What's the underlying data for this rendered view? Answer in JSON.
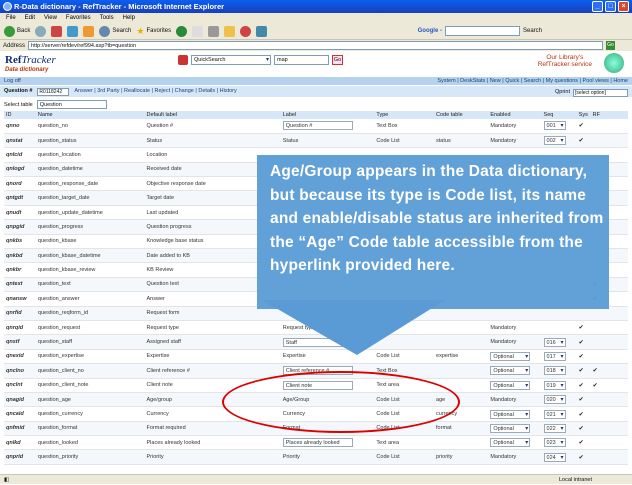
{
  "window": {
    "title": "R-Data dictionary - RefTracker - Microsoft Internet Explorer"
  },
  "menu": [
    "File",
    "Edit",
    "View",
    "Favorites",
    "Tools",
    "Help"
  ],
  "toolbar": {
    "back": "Back",
    "search": "Search",
    "favorites": "Favorites",
    "google_label": "Google -",
    "search_btn": "Search"
  },
  "address": {
    "label": "Address",
    "url": "http://server/refdev/ref994.asp?tb=question",
    "go": "Go"
  },
  "app": {
    "logo_bold": "Ref",
    "logo_italic": "Tracker",
    "subtitle": "Data dictionary",
    "quicksearch_label": "QuickSearch",
    "quicksearch_value": "map",
    "go": "Go",
    "library_line1": "Our Library's",
    "library_line2": "RefTracker service"
  },
  "nav": {
    "logoff": "Log off",
    "links": "System | DeskStats | New | Quick | Search | My questions | Pool views | Home"
  },
  "qbar": {
    "label": "Question #",
    "value": "R0118242",
    "actions": "Answer | 3rd Party | Reallocate | Reject | Change | Details | History",
    "qprint": "Qprint",
    "option": "[select option]"
  },
  "table_select": {
    "label": "Select table",
    "value": "Question"
  },
  "columns": [
    "ID",
    "Name",
    "Default label",
    "Label",
    "Type",
    "Code table",
    "Enabled",
    "Seq",
    "Sys",
    "RF"
  ],
  "rows": [
    {
      "id": "qnno",
      "name": "question_no",
      "default": "Question #",
      "label": "Question #",
      "type": "Text Box",
      "code": "",
      "enabled": "Mandatory",
      "seq": "001",
      "sys": "✔",
      "rf": "",
      "input": true,
      "sel": false
    },
    {
      "id": "qnstat",
      "name": "question_status",
      "default": "Status",
      "label": "Status",
      "type": "Code List",
      "code": "status",
      "enabled": "Mandatory",
      "seq": "002",
      "sys": "✔",
      "rf": "",
      "input": false,
      "sel": false
    },
    {
      "id": "qnlcid",
      "name": "question_location",
      "default": "Location",
      "label": "",
      "type": "",
      "code": "",
      "enabled": "",
      "seq": "",
      "sys": "",
      "rf": "",
      "input": false,
      "sel": false
    },
    {
      "id": "qnlogd",
      "name": "question_datetime",
      "default": "Received date",
      "label": "",
      "type": "",
      "code": "",
      "enabled": "",
      "seq": "",
      "sys": "",
      "rf": "",
      "input": false,
      "sel": false
    },
    {
      "id": "qnord",
      "name": "question_response_date",
      "default": "Objective response date",
      "label": "",
      "type": "",
      "code": "",
      "enabled": "",
      "seq": "",
      "sys": "",
      "rf": "",
      "input": false,
      "sel": false
    },
    {
      "id": "qntgdt",
      "name": "question_target_date",
      "default": "Target date",
      "label": "",
      "type": "",
      "code": "",
      "enabled": "",
      "seq": "",
      "sys": "",
      "rf": "",
      "input": false,
      "sel": false
    },
    {
      "id": "qnudt",
      "name": "question_update_datetime",
      "default": "Last updated",
      "label": "",
      "type": "",
      "code": "",
      "enabled": "",
      "seq": "",
      "sys": "",
      "rf": "",
      "input": false,
      "sel": false
    },
    {
      "id": "qnpgid",
      "name": "question_progress",
      "default": "Question progress",
      "label": "",
      "type": "",
      "code": "",
      "enabled": "",
      "seq": "",
      "sys": "",
      "rf": "",
      "input": false,
      "sel": false
    },
    {
      "id": "qnkbs",
      "name": "question_kbase",
      "default": "Knowledge base status",
      "label": "",
      "type": "",
      "code": "",
      "enabled": "",
      "seq": "",
      "sys": "",
      "rf": "",
      "input": false,
      "sel": false
    },
    {
      "id": "qnkbd",
      "name": "question_kbase_datetime",
      "default": "Date added to KB",
      "label": "",
      "type": "",
      "code": "",
      "enabled": "",
      "seq": "",
      "sys": "",
      "rf": "",
      "input": false,
      "sel": false
    },
    {
      "id": "qnkbr",
      "name": "question_kbase_review",
      "default": "KB Review",
      "label": "",
      "type": "",
      "code": "",
      "enabled": "",
      "seq": "",
      "sys": "",
      "rf": "",
      "input": false,
      "sel": false
    },
    {
      "id": "qntext",
      "name": "question_text",
      "default": "Question text",
      "label": "",
      "type": "",
      "code": "",
      "enabled": "",
      "seq": "",
      "sys": "",
      "rf": "✔",
      "input": false,
      "sel": false
    },
    {
      "id": "qnansw",
      "name": "question_answer",
      "default": "Answer",
      "label": "",
      "type": "",
      "code": "",
      "enabled": "",
      "seq": "",
      "sys": "",
      "rf": "✔",
      "input": false,
      "sel": false
    },
    {
      "id": "qnrfid",
      "name": "question_reqform_id",
      "default": "Request form",
      "label": "",
      "type": "",
      "code": "",
      "enabled": "",
      "seq": "",
      "sys": "",
      "rf": "",
      "input": false,
      "sel": false
    },
    {
      "id": "qnrqid",
      "name": "question_request",
      "default": "Request type",
      "label": "Request type",
      "type": "",
      "code": "",
      "enabled": "Mandatory",
      "seq": "",
      "sys": "✔",
      "rf": "",
      "input": false,
      "sel": false
    },
    {
      "id": "qnstf",
      "name": "question_staff",
      "default": "Assigned staff",
      "label": "Staff",
      "type": "",
      "code": "",
      "enabled": "Mandatory",
      "seq": "016",
      "sys": "✔",
      "rf": "",
      "input": true,
      "sel": false
    },
    {
      "id": "qnexid",
      "name": "question_expertise",
      "default": "Expertise",
      "label": "Expertise",
      "type": "Code List",
      "code": "expertise",
      "enabled": "Optional",
      "seq": "017",
      "sys": "✔",
      "rf": "",
      "input": false,
      "sel": true
    },
    {
      "id": "qnclno",
      "name": "question_client_no",
      "default": "Client reference #",
      "label": "Client reference #",
      "type": "Text Box",
      "code": "",
      "enabled": "Optional",
      "seq": "018",
      "sys": "✔",
      "rf": "✔",
      "input": true,
      "sel": true
    },
    {
      "id": "qnclnt",
      "name": "question_client_note",
      "default": "Client note",
      "label": "Client note",
      "type": "Text area",
      "code": "",
      "enabled": "Optional",
      "seq": "019",
      "sys": "✔",
      "rf": "✔",
      "input": true,
      "sel": true
    },
    {
      "id": "qnagid",
      "name": "question_age",
      "default": "Age/group",
      "label": "Age/Group",
      "type": "Code List",
      "code": "age",
      "enabled": "Mandatory",
      "seq": "020",
      "sys": "✔",
      "rf": "",
      "input": false,
      "sel": false
    },
    {
      "id": "qncaid",
      "name": "question_currency",
      "default": "Currency",
      "label": "Currency",
      "type": "Code List",
      "code": "currency",
      "enabled": "Optional",
      "seq": "021",
      "sys": "✔",
      "rf": "",
      "input": false,
      "sel": true
    },
    {
      "id": "qnfmid",
      "name": "question_format",
      "default": "Format required",
      "label": "Format",
      "type": "Code List",
      "code": "format",
      "enabled": "Optional",
      "seq": "022",
      "sys": "✔",
      "rf": "",
      "input": false,
      "sel": true
    },
    {
      "id": "qnlkd",
      "name": "question_looked",
      "default": "Places already looked",
      "label": "Places already looked",
      "type": "Text area",
      "code": "",
      "enabled": "Optional",
      "seq": "023",
      "sys": "✔",
      "rf": "",
      "input": true,
      "sel": true
    },
    {
      "id": "qnprid",
      "name": "question_priority",
      "default": "Priority",
      "label": "Priority",
      "type": "Code List",
      "code": "priority",
      "enabled": "Mandatory",
      "seq": "024",
      "sys": "✔",
      "rf": "",
      "input": false,
      "sel": false
    }
  ],
  "callout": {
    "text": "Age/Group appears in the Data dictionary, but because its type is Code list, its name and enable/disable status are inherited from the “Age” Code table accessible from the hyperlink provided here."
  },
  "status": {
    "zone": "Local intranet"
  },
  "colors": {
    "callout": "#5a9bd6",
    "oval": "#dd0000",
    "nav": "#b5d3ee"
  }
}
